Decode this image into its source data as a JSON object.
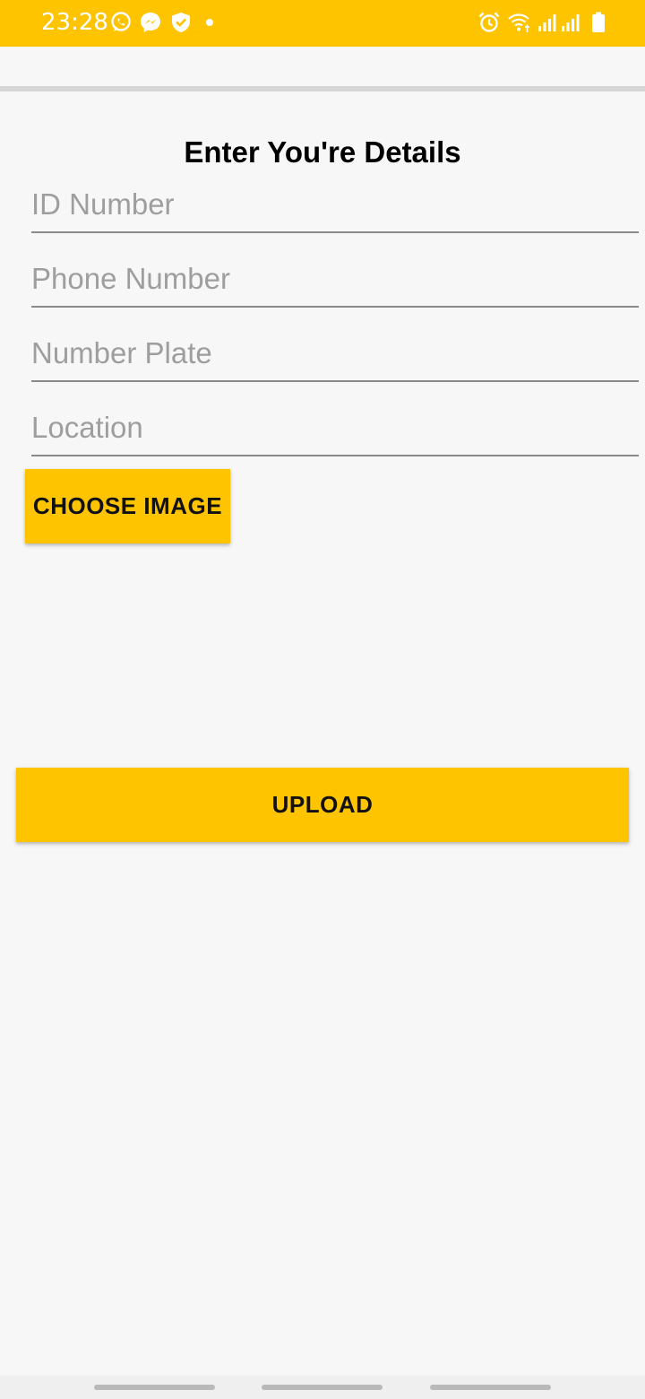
{
  "status_bar": {
    "time": "23:28",
    "background_color": "#ffc400",
    "left_icons": [
      "whatsapp-icon",
      "messenger-icon",
      "shield-check-icon",
      "notification-dot"
    ],
    "right_icons": [
      "alarm-icon",
      "wifi-icon",
      "signal-icon",
      "signal-icon",
      "battery-icon"
    ]
  },
  "form": {
    "title": "Enter You're Details",
    "fields": [
      {
        "placeholder": "ID Number",
        "value": ""
      },
      {
        "placeholder": "Phone Number",
        "value": ""
      },
      {
        "placeholder": "Number Plate",
        "value": ""
      },
      {
        "placeholder": "Location",
        "value": ""
      }
    ],
    "choose_image_label": "CHOOSE IMAGE",
    "upload_label": "UPLOAD"
  },
  "colors": {
    "accent": "#ffc400",
    "background": "#f7f7f7",
    "text": "#000000",
    "placeholder": "#9e9e9e"
  }
}
